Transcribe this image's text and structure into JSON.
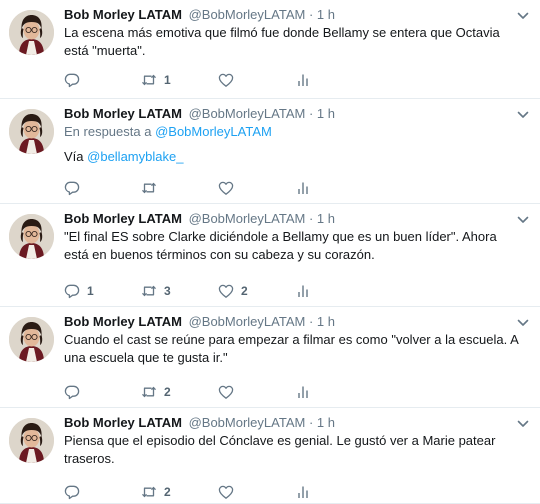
{
  "account": {
    "name": "Bob Morley LATAM",
    "handle": "@BobMorleyLATAM"
  },
  "colors": {
    "text": "#14171a",
    "secondary": "#657786",
    "link": "#1da1f2",
    "divider": "#e6ecf0"
  },
  "icons": {
    "reply": "reply-icon",
    "retweet": "retweet-icon",
    "like": "heart-icon",
    "analytics": "analytics-icon",
    "menu": "chevron-down-icon"
  },
  "tweets": [
    {
      "name": "Bob Morley LATAM",
      "handle": "@BobMorleyLATAM",
      "separator": "·",
      "time": "1 h",
      "text": "La escena más emotiva que filmó fue donde Bellamy se entera que Octavia está \"muerta\".",
      "reply_count": "",
      "retweet_count": "1",
      "like_count": ""
    },
    {
      "name": "Bob Morley LATAM",
      "handle": "@BobMorleyLATAM",
      "separator": "·",
      "time": "1 h",
      "reply_prefix": "En respuesta a",
      "reply_handle": "@BobMorleyLATAM",
      "text_prefix": "Vía",
      "text_link": "@bellamyblake_",
      "reply_count": "",
      "retweet_count": "",
      "like_count": ""
    },
    {
      "name": "Bob Morley LATAM",
      "handle": "@BobMorleyLATAM",
      "separator": "·",
      "time": "1 h",
      "text": "\"El final ES sobre Clarke diciéndole a Bellamy que es un buen líder\". Ahora está en buenos términos con su cabeza y su corazón.",
      "reply_count": "1",
      "retweet_count": "3",
      "like_count": "2"
    },
    {
      "name": "Bob Morley LATAM",
      "handle": "@BobMorleyLATAM",
      "separator": "·",
      "time": "1 h",
      "text": "Cuando el cast se reúne para empezar a filmar es como \"volver a la escuela. A una escuela que te gusta ir.\"",
      "reply_count": "",
      "retweet_count": "2",
      "like_count": ""
    },
    {
      "name": "Bob Morley LATAM",
      "handle": "@BobMorleyLATAM",
      "separator": "·",
      "time": "1 h",
      "text": "Piensa que el episodio del Cónclave es genial. Le gustó ver a Marie patear traseros.",
      "reply_count": "",
      "retweet_count": "2",
      "like_count": ""
    }
  ]
}
